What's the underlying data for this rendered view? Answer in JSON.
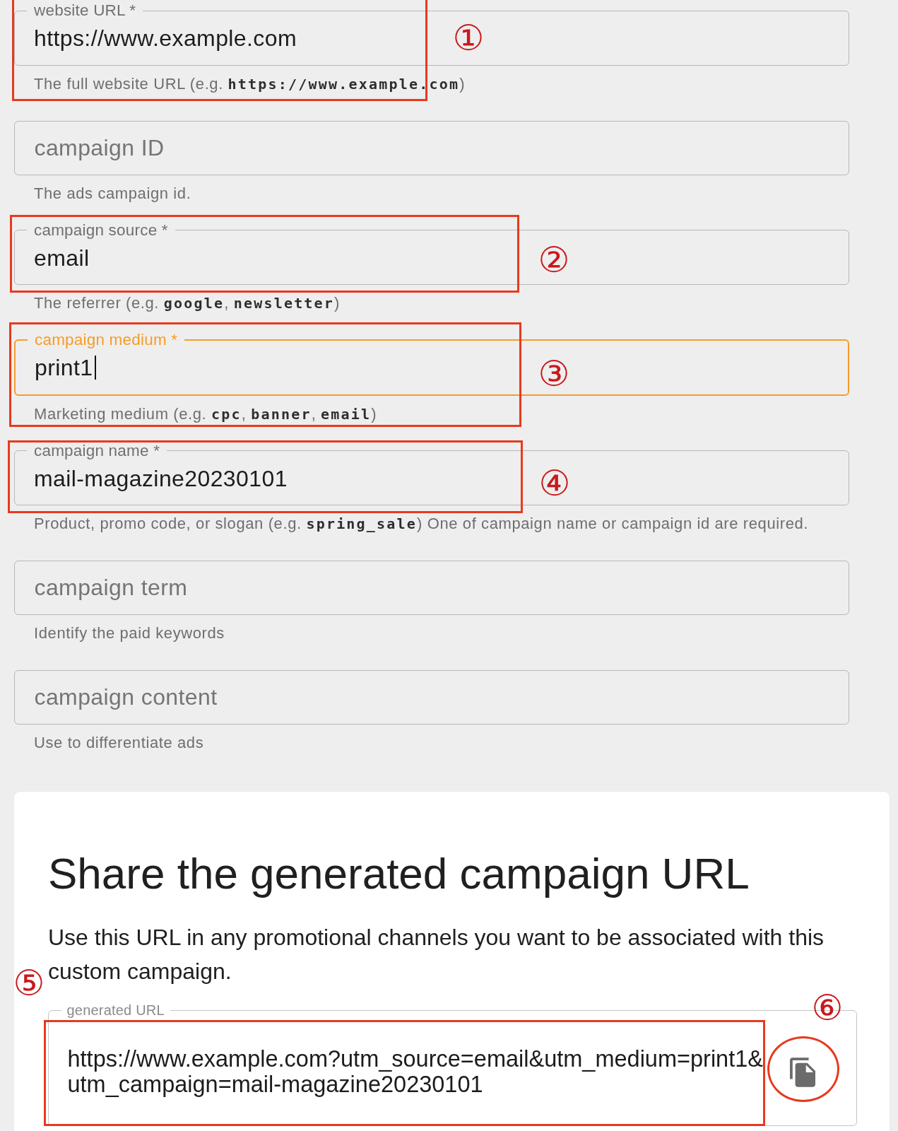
{
  "fields": [
    {
      "kind": "filled",
      "label": "website URL *",
      "value": "https://www.example.com",
      "focused": false,
      "helper": "The full website URL (e.g. **https://www.example.com**)"
    },
    {
      "kind": "empty",
      "placeholder": "campaign ID",
      "focused": false,
      "helper": "The ads campaign id."
    },
    {
      "kind": "filled",
      "label": "campaign source *",
      "value": "email",
      "focused": false,
      "helper": "The referrer (e.g. **google**, **newsletter**)"
    },
    {
      "kind": "filled",
      "label": "campaign medium *",
      "value": "print1",
      "focused": true,
      "helper": "Marketing medium (e.g. **cpc**, **banner**, **email**)"
    },
    {
      "kind": "filled",
      "label": "campaign name *",
      "value": "mail-magazine20230101",
      "focused": false,
      "helper": "Product, promo code, or slogan (e.g. **spring_sale**) One of campaign name or campaign id are required."
    },
    {
      "kind": "empty",
      "placeholder": "campaign term",
      "focused": false,
      "helper": "Identify the paid keywords"
    },
    {
      "kind": "empty",
      "placeholder": "campaign content",
      "focused": false,
      "helper": "Use to differentiate ads"
    }
  ],
  "share_card": {
    "title": "Share the generated campaign URL",
    "description": "Use this URL in any promotional channels you want to be associated with this custom campaign.",
    "url_field": {
      "label": "generated URL",
      "value": "https://www.example.com?utm_source=email&utm_medium=print1&utm_campaign=mail-magazine20230101"
    }
  },
  "annotations": [
    {
      "kind": "rectangle",
      "number": "①"
    },
    {
      "kind": "rectangle",
      "number": "②"
    },
    {
      "kind": "rectangle",
      "number": "③"
    },
    {
      "kind": "rectangle",
      "number": "④"
    },
    {
      "kind": "rectangle",
      "number": "⑤"
    },
    {
      "kind": "ellipse",
      "number": "⑥"
    }
  ]
}
